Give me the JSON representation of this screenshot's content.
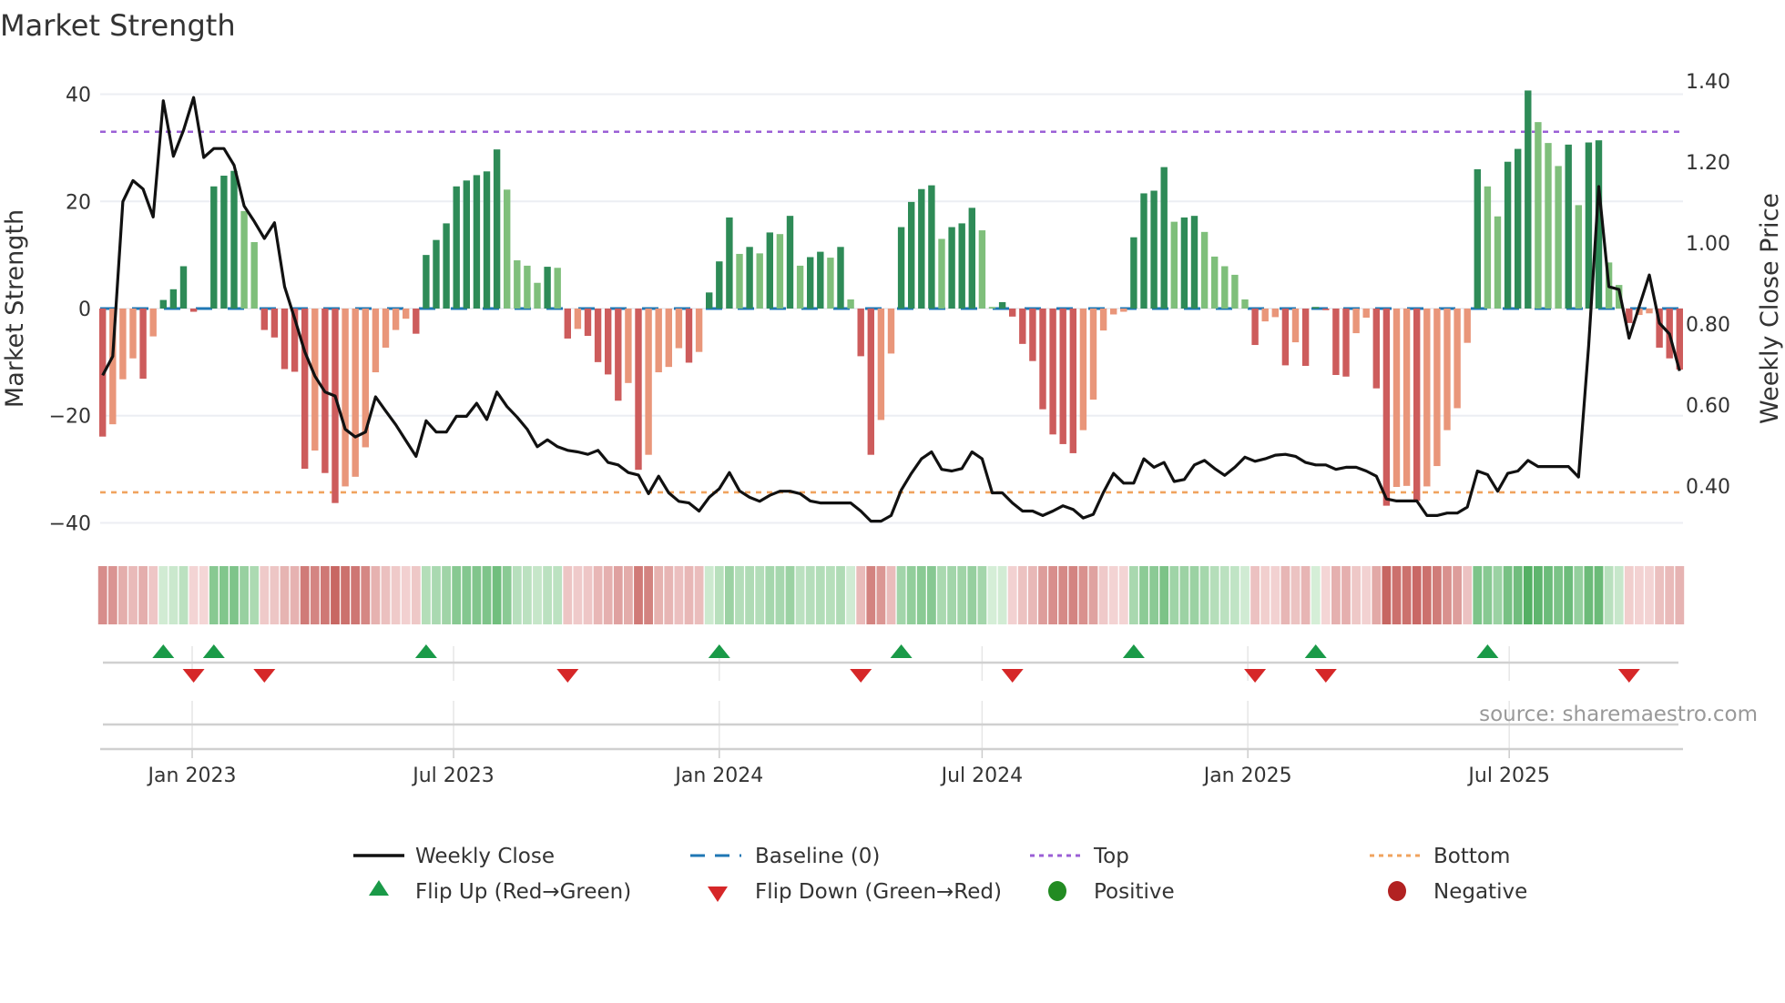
{
  "title": "Market Strength",
  "source": "source: sharemaestro.com",
  "legend": {
    "weekly_close": "Weekly Close",
    "baseline": "Baseline (0)",
    "top": "Top",
    "bottom": "Bottom",
    "flip_up": "Flip Up (Red→Green)",
    "flip_down": "Flip Down (Green→Red)",
    "positive": "Positive",
    "negative": "Negative"
  },
  "colors": {
    "pos_rising": "#2e8b57",
    "pos_falling": "#7fbf7b",
    "neg_falling": "#cd5c5c",
    "neg_rising": "#e9967a",
    "close": "#111111",
    "baseline": "#1f77b4",
    "top": "#9b5fd6",
    "bottom": "#f0a35e",
    "flip_up": "#1a9a48",
    "flip_down": "#d62728",
    "positive": "#228b22",
    "negative": "#b22222"
  },
  "chart_data": {
    "type": "bar",
    "title": "Market Strength",
    "ylabel": "Market Strength",
    "y2label": "Weekly Close Price",
    "ylim": [
      -44,
      44
    ],
    "y2lim": [
      0.256,
      1.42
    ],
    "yticks": [
      -40,
      -20,
      0,
      20,
      40
    ],
    "y2ticks": [
      0.4,
      0.6,
      0.8,
      1.0,
      1.2,
      1.4
    ],
    "start_date": "2022-10-31",
    "interval_days": 7,
    "xticks": [
      {
        "date": "2023-01-01",
        "label": "Jan 2023"
      },
      {
        "date": "2023-07-01",
        "label": "Jul 2023"
      },
      {
        "date": "2024-01-01",
        "label": "Jan 2024"
      },
      {
        "date": "2024-07-01",
        "label": "Jul 2024"
      },
      {
        "date": "2025-01-01",
        "label": "Jan 2025"
      },
      {
        "date": "2025-07-01",
        "label": "Jul 2025"
      }
    ],
    "top_level": 33,
    "bottom_level": -34.3,
    "baseline": 0,
    "strength": [
      -23.9,
      -21.6,
      -13.2,
      -9.3,
      -13.1,
      -5.2,
      1.6,
      3.6,
      7.9,
      -0.6,
      0,
      22.8,
      24.8,
      25.7,
      18.2,
      12.4,
      -4.0,
      -5.4,
      -11.3,
      -11.8,
      -29.9,
      -26.5,
      -30.7,
      -36.3,
      -33.2,
      -31.4,
      -25.9,
      -11.9,
      -7.3,
      -4.0,
      -1.9,
      -4.7,
      10.0,
      12.8,
      15.9,
      22.8,
      23.9,
      24.9,
      25.6,
      29.7,
      22.2,
      9.0,
      8.0,
      4.8,
      7.8,
      7.6,
      -5.6,
      -3.8,
      -5.1,
      -10.0,
      -12.3,
      -17.2,
      -13.9,
      -30.1,
      -27.3,
      -11.9,
      -10.9,
      -7.4,
      -10.1,
      -8.1,
      3.0,
      8.8,
      17.0,
      10.2,
      11.5,
      10.3,
      14.2,
      13.9,
      17.3,
      8.0,
      9.6,
      10.6,
      9.5,
      11.5,
      1.7,
      -8.9,
      -27.3,
      -20.8,
      -8.4,
      15.2,
      19.9,
      22.3,
      23.0,
      13.0,
      15.2,
      15.9,
      18.8,
      14.6,
      0.3,
      1.2,
      -1.5,
      -6.6,
      -9.8,
      -18.8,
      -23.5,
      -25.3,
      -27.0,
      -22.7,
      -17.0,
      -4.1,
      -1.1,
      -0.6,
      13.3,
      21.5,
      22.0,
      26.4,
      16.2,
      17.0,
      17.3,
      14.3,
      9.7,
      7.9,
      6.3,
      1.7,
      -6.8,
      -2.4,
      -1.6,
      -10.6,
      -6.3,
      -10.7,
      0.3,
      -0.3,
      -12.4,
      -12.7,
      -4.6,
      -1.7,
      -14.9,
      -36.8,
      -33.3,
      -33.1,
      -35.9,
      -33.2,
      -29.4,
      -22.7,
      -18.6,
      -6.4,
      26.0,
      22.8,
      17.2,
      27.4,
      29.8,
      40.7,
      34.8,
      30.9,
      26.6,
      30.6,
      19.3,
      31.0,
      31.4,
      8.6,
      4.4,
      -2.7,
      -1.2,
      -0.9,
      -7.3,
      -9.3,
      -11.4
    ],
    "weekly_close": [
      0.673,
      0.72,
      1.102,
      1.154,
      1.133,
      1.064,
      1.351,
      1.214,
      1.278,
      1.359,
      1.211,
      1.233,
      1.233,
      1.192,
      1.091,
      1.053,
      1.011,
      1.05,
      0.892,
      0.813,
      0.731,
      0.671,
      0.632,
      0.622,
      0.54,
      0.521,
      0.533,
      0.62,
      0.585,
      0.551,
      0.512,
      0.473,
      0.561,
      0.533,
      0.533,
      0.572,
      0.572,
      0.604,
      0.564,
      0.632,
      0.596,
      0.57,
      0.54,
      0.497,
      0.514,
      0.497,
      0.488,
      0.484,
      0.478,
      0.488,
      0.458,
      0.452,
      0.433,
      0.427,
      0.381,
      0.424,
      0.383,
      0.362,
      0.358,
      0.338,
      0.372,
      0.393,
      0.433,
      0.388,
      0.372,
      0.362,
      0.377,
      0.387,
      0.387,
      0.381,
      0.363,
      0.358,
      0.358,
      0.358,
      0.358,
      0.338,
      0.313,
      0.313,
      0.327,
      0.39,
      0.431,
      0.467,
      0.484,
      0.441,
      0.437,
      0.443,
      0.484,
      0.467,
      0.383,
      0.383,
      0.358,
      0.338,
      0.338,
      0.327,
      0.338,
      0.351,
      0.342,
      0.321,
      0.33,
      0.384,
      0.431,
      0.407,
      0.407,
      0.467,
      0.446,
      0.458,
      0.411,
      0.416,
      0.452,
      0.463,
      0.443,
      0.426,
      0.446,
      0.471,
      0.461,
      0.467,
      0.476,
      0.478,
      0.473,
      0.458,
      0.452,
      0.452,
      0.441,
      0.446,
      0.446,
      0.437,
      0.424,
      0.368,
      0.363,
      0.363,
      0.363,
      0.327,
      0.327,
      0.333,
      0.333,
      0.348,
      0.437,
      0.428,
      0.387,
      0.431,
      0.437,
      0.463,
      0.448,
      0.448,
      0.448,
      0.448,
      0.422,
      0.746,
      1.139,
      0.892,
      0.885,
      0.765,
      0.843,
      0.921,
      0.802,
      0.775,
      0.684
    ],
    "flip_up_weeks": [
      7,
      12,
      33,
      62,
      80,
      103,
      121,
      138
    ],
    "flip_down_weeks": [
      10,
      17,
      47,
      76,
      91,
      115,
      122,
      152
    ],
    "legend_position": "bottom"
  }
}
